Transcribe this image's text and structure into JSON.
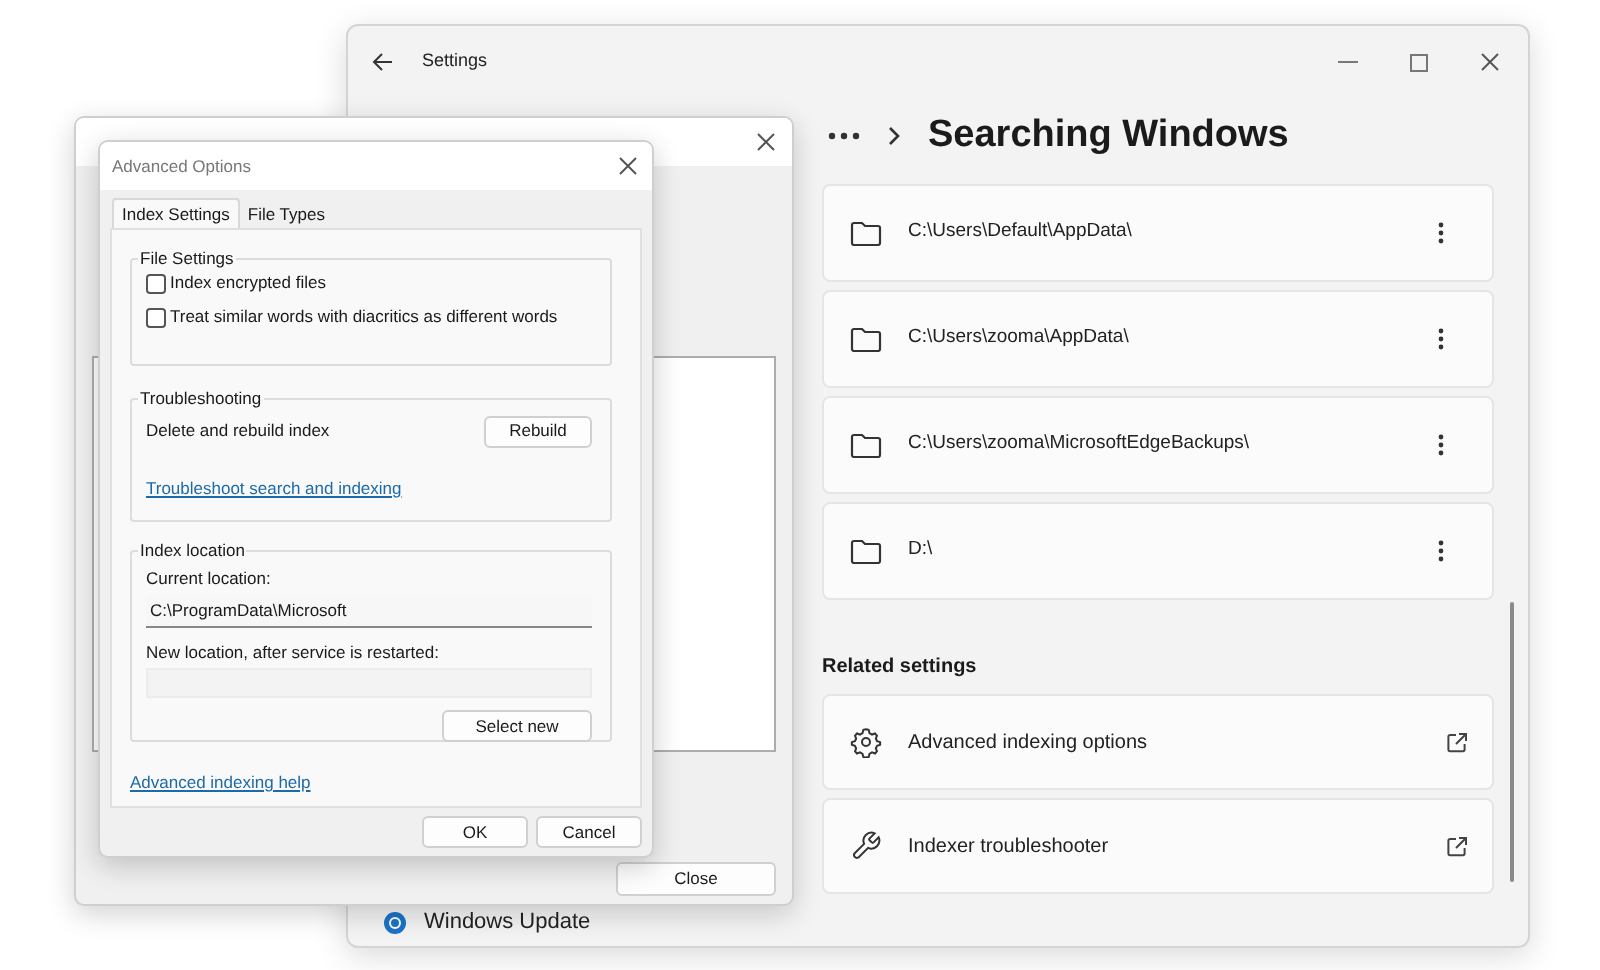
{
  "settings_window": {
    "title": "Settings",
    "heading": "Searching Windows",
    "folders": [
      {
        "path": "C:\\Users\\Default\\AppData\\"
      },
      {
        "path": "C:\\Users\\zooma\\AppData\\"
      },
      {
        "path": "C:\\Users\\zooma\\MicrosoftEdgeBackups\\"
      },
      {
        "path": "D:\\"
      }
    ],
    "related_settings": {
      "heading": "Related settings",
      "items": [
        {
          "kind": "gear",
          "label": "Advanced indexing options"
        },
        {
          "kind": "wrench",
          "label": "Indexer troubleshooter"
        }
      ]
    },
    "sidebar_items": [
      {
        "label": "Windows Update"
      }
    ]
  },
  "indexing_options_window": {
    "close_button": "Close"
  },
  "advanced_options_dialog": {
    "title": "Advanced Options",
    "tabs": [
      {
        "label": "Index Settings",
        "selected": true
      },
      {
        "label": "File Types",
        "selected": false
      }
    ],
    "file_settings": {
      "legend": "File Settings",
      "options": [
        {
          "label": "Index encrypted files",
          "checked": false
        },
        {
          "label": "Treat similar words with diacritics as different words",
          "checked": false
        }
      ]
    },
    "troubleshooting": {
      "legend": "Troubleshooting",
      "label": "Delete and rebuild index",
      "button": "Rebuild",
      "link": "Troubleshoot search and indexing"
    },
    "index_location": {
      "legend": "Index location",
      "current_label": "Current location:",
      "current_value": "C:\\ProgramData\\Microsoft",
      "new_label": "New location, after service is restarted:",
      "button": "Select new"
    },
    "help_link": "Advanced indexing help",
    "buttons": [
      "OK",
      "Cancel"
    ]
  }
}
